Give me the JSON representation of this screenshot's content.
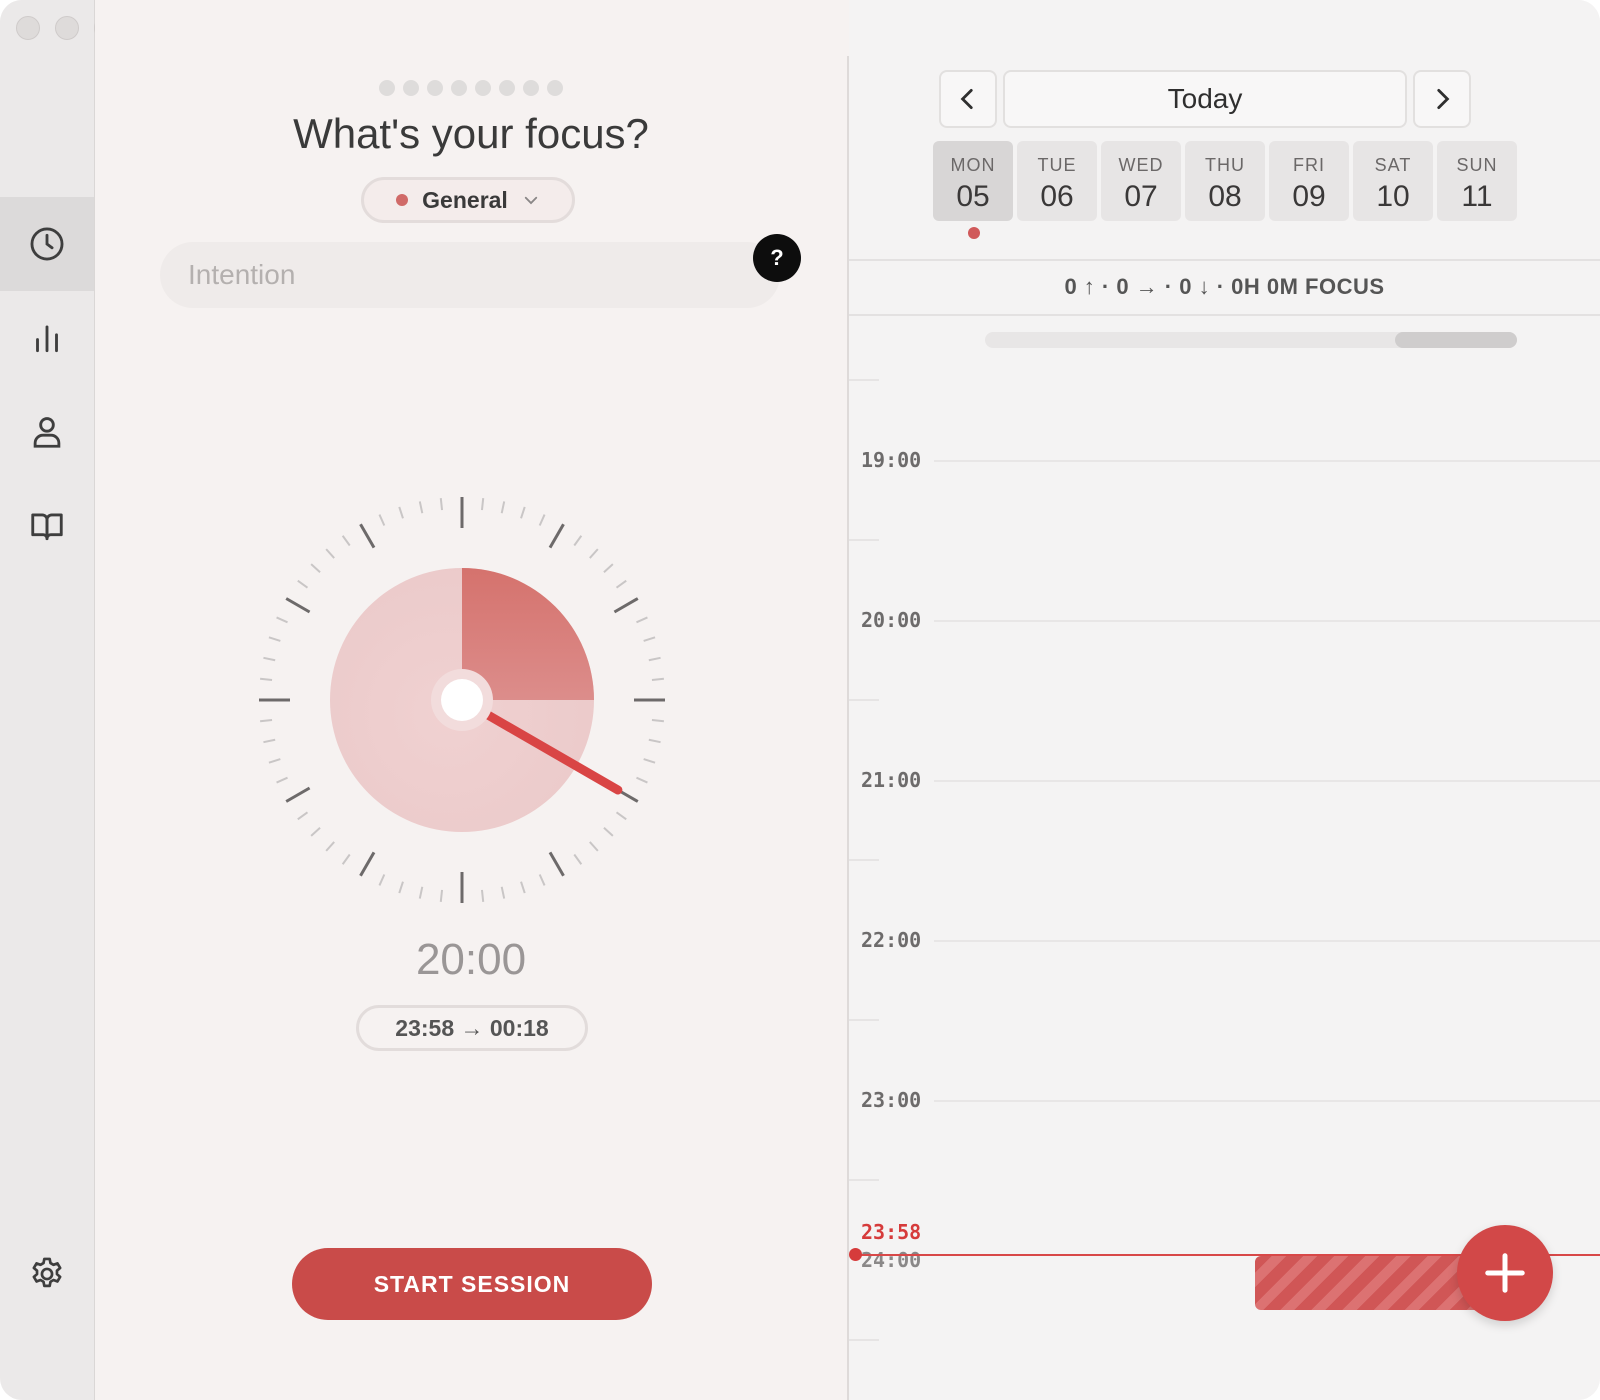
{
  "main": {
    "title": "What's your focus?",
    "category_label": "General",
    "intention_placeholder": "Intention",
    "help_label": "?",
    "duration": "20:00",
    "time_range": "23:58 → 00:18",
    "start_button": "START SESSION",
    "timer_progress_fraction": 0.25
  },
  "colors": {
    "accent": "#d05656",
    "category_dot": "#d06a68",
    "start_button": "#c94b49"
  },
  "sidebar": {
    "items": [
      {
        "icon": "clock-icon",
        "active": true
      },
      {
        "icon": "stats-icon",
        "active": false
      },
      {
        "icon": "profile-icon",
        "active": false
      },
      {
        "icon": "book-icon",
        "active": false
      }
    ],
    "settings_icon": "gear-icon"
  },
  "calendar": {
    "today_label": "Today",
    "days": [
      {
        "name": "MON",
        "date": "05"
      },
      {
        "name": "TUE",
        "date": "06"
      },
      {
        "name": "WED",
        "date": "07"
      },
      {
        "name": "THU",
        "date": "08"
      },
      {
        "name": "FRI",
        "date": "09"
      },
      {
        "name": "SAT",
        "date": "10"
      },
      {
        "name": "SUN",
        "date": "11"
      }
    ],
    "stats": "0 ↑ · 0 → · 0 ↓ · 0H 0M FOCUS",
    "hours": [
      "19:00",
      "20:00",
      "21:00",
      "22:00",
      "23:00",
      "24:00"
    ],
    "now_label": "23:58"
  }
}
